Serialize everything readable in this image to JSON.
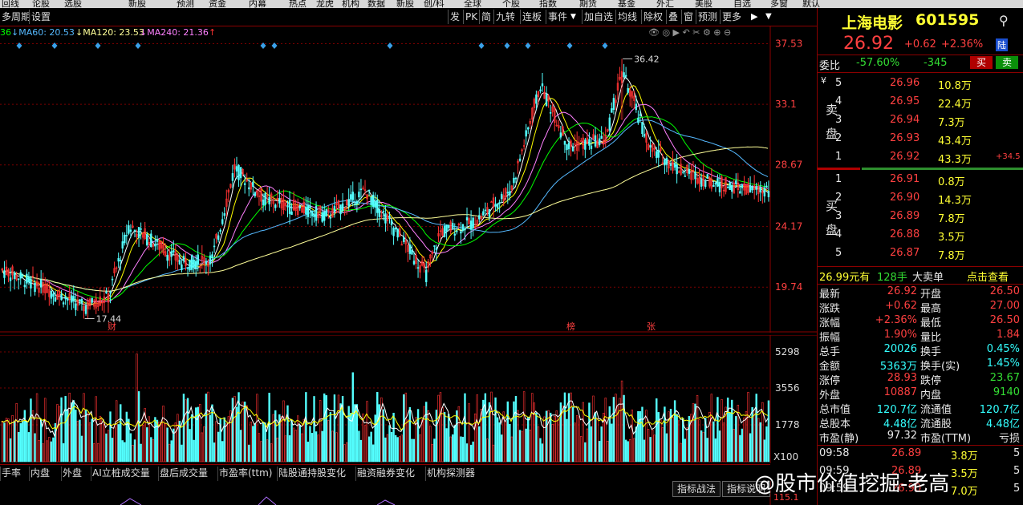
{
  "top_menu": [
    "回线",
    "论股",
    "选股",
    "新股",
    "预测",
    "资金",
    "内幕",
    "热点",
    "龙虎",
    "机构",
    "数据",
    "新股",
    "创/科",
    "全球",
    "个股",
    "指数",
    "期货",
    "基金",
    "外汇",
    "美股",
    "自选",
    "多窗",
    "默认"
  ],
  "toolbar": {
    "left": [
      "多周期",
      "设置"
    ],
    "right": [
      "发",
      "PK",
      "简",
      "九转",
      "连板",
      "事件",
      "加自选",
      "均线",
      "除权",
      "叠",
      "窗",
      "预测",
      "更多"
    ],
    "event_arrow": "▼",
    "play_icon": "▶",
    "menu_icon": "▼"
  },
  "ma_labels": {
    "ma30_tail": "36",
    "ma60": "MA60: 20.53",
    "ma120": "MA120: 23.53",
    "ma240": "MA240: 21.36"
  },
  "colors": {
    "up": "#ff3232",
    "down": "#54ffff",
    "ma5": "#ffffff",
    "ma10": "#ffff00",
    "ma20": "#ff80ff",
    "ma30": "#00ff00",
    "ma60": "#55b9ff",
    "ma120": "#ffff99",
    "grid": "#7a0000"
  },
  "chart_data": {
    "type": "candlestick",
    "price_axis_ticks": [
      37.53,
      33.1,
      28.67,
      24.17,
      19.74
    ],
    "volume_axis_ticks": [
      5298,
      3556,
      1778
    ],
    "volume_unit": "X100",
    "indicator_tick": "115.1",
    "high_label": "36.42",
    "low_label": "17.44",
    "event_markers": [
      "财",
      "榜",
      "张"
    ],
    "ylim": [
      17.0,
      38.2
    ]
  },
  "bottom_tabs": [
    "手率",
    "内盘",
    "外盘",
    "AI立桩成交量",
    "盘后成交量",
    "市盈率(ttm)",
    "陆股通持股变化",
    "融资融券变化",
    "机构探测器"
  ],
  "indicator_buttons": [
    "指标战法",
    "指标说明"
  ],
  "quote": {
    "name": "上海电影",
    "code": "601595",
    "price": "26.92",
    "change": "+0.62",
    "change_pct": "+2.36%",
    "market_badge": "陆",
    "wei_bi_label": "委比",
    "wei_bi": "-57.60%",
    "wei_cha": "-345",
    "buy_btn": "买",
    "sell_btn": "卖",
    "side_sell": "卖盘",
    "side_buy": "买盘",
    "yen": "¥",
    "sell_levels": [
      {
        "level": "5",
        "price": "26.96",
        "vol": "10.8万",
        "extra": ""
      },
      {
        "level": "4",
        "price": "26.95",
        "vol": "22.4万",
        "extra": ""
      },
      {
        "level": "3",
        "price": "26.94",
        "vol": "7.3万",
        "extra": ""
      },
      {
        "level": "2",
        "price": "26.93",
        "vol": "43.4万",
        "extra": ""
      },
      {
        "level": "1",
        "price": "26.92",
        "vol": "43.3万",
        "extra": "+34.5"
      }
    ],
    "buy_levels": [
      {
        "level": "1",
        "price": "26.91",
        "vol": "0.8万"
      },
      {
        "level": "2",
        "price": "26.90",
        "vol": "14.3万"
      },
      {
        "level": "3",
        "price": "26.89",
        "vol": "7.8万"
      },
      {
        "level": "4",
        "price": "26.88",
        "vol": "3.5万"
      },
      {
        "level": "5",
        "price": "26.87",
        "vol": "7.8万"
      }
    ],
    "big_order": {
      "price": "26.99元有",
      "qty": "128手",
      "label": "大卖单",
      "link": "点击查看"
    },
    "stats": [
      {
        "l1": "最新",
        "v1": "26.92",
        "c1": "red",
        "l2": "开盘",
        "v2": "26.50",
        "c2": "red"
      },
      {
        "l1": "涨跌",
        "v1": "+0.62",
        "c1": "red",
        "l2": "最高",
        "v2": "27.00",
        "c2": "red"
      },
      {
        "l1": "涨幅",
        "v1": "+2.36%",
        "c1": "red",
        "l2": "最低",
        "v2": "26.50",
        "c2": "red"
      },
      {
        "l1": "振幅",
        "v1": "1.90%",
        "c1": "red",
        "l2": "量比",
        "v2": "1.84",
        "c2": "red"
      },
      {
        "l1": "总手",
        "v1": "20026",
        "c1": "cyan",
        "l2": "换手",
        "v2": "0.45%",
        "c2": "cyan"
      },
      {
        "l1": "金额",
        "v1": "5363万",
        "c1": "cyan",
        "l2": "换手(实)",
        "v2": "1.45%",
        "c2": "cyan"
      },
      {
        "l1": "涨停",
        "v1": "28.93",
        "c1": "red",
        "l2": "跌停",
        "v2": "23.67",
        "c2": "green"
      },
      {
        "l1": "外盘",
        "v1": "10887",
        "c1": "red",
        "l2": "内盘",
        "v2": "9140",
        "c2": "green"
      },
      {
        "l1": "总市值",
        "v1": "120.7亿",
        "c1": "cyan",
        "l2": "流通值",
        "v2": "120.7亿",
        "c2": "cyan"
      },
      {
        "l1": "总股本",
        "v1": "4.48亿",
        "c1": "cyan",
        "l2": "流通股",
        "v2": "4.48亿",
        "c2": "cyan"
      },
      {
        "l1": "市盈(静)",
        "v1": "97.32",
        "c1": "white",
        "l2": "市盈(TTM)",
        "v2": "亏损",
        "c2": "white"
      }
    ],
    "ticks": [
      {
        "time": "09:58",
        "price": "26.89",
        "vol": "3.8万",
        "n": "5"
      },
      {
        "time": "09:59",
        "price": "26.89",
        "vol": "3.5万",
        "n": "5"
      },
      {
        "time": "09:59",
        "price": "26.90",
        "vol": "7.0万",
        "n": "5"
      }
    ]
  },
  "watermark": "@股市价值挖掘-老高"
}
